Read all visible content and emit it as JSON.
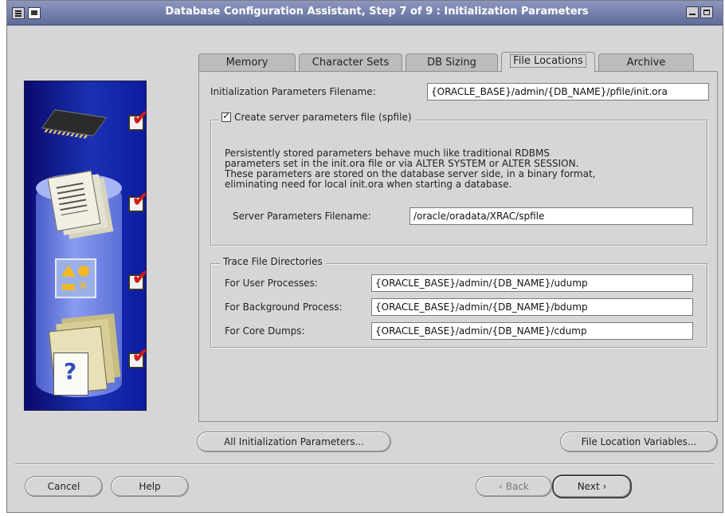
{
  "window": {
    "title": "Database Configuration Assistant, Step 7 of 9 : Initialization Parameters"
  },
  "tabs": [
    {
      "label": "Memory",
      "active": false
    },
    {
      "label": "Character Sets",
      "active": false
    },
    {
      "label": "DB Sizing",
      "active": false
    },
    {
      "label": "File Locations",
      "active": true
    },
    {
      "label": "Archive",
      "active": false
    }
  ],
  "init_params": {
    "label": "Initialization Parameters Filename:",
    "value": "{ORACLE_BASE}/admin/{DB_NAME}/pfile/init.ora"
  },
  "spfile": {
    "checkbox_label": "Create server parameters file (spfile)",
    "checked": true,
    "description_lines": [
      "Persistently stored parameters behave much like traditional RDBMS",
      "parameters set in the init.ora file or via ALTER SYSTEM or ALTER SESSION.",
      "These parameters are stored on the database server side, in a binary format,",
      "eliminating need for local init.ora when starting a database."
    ],
    "filename_label": "Server Parameters Filename:",
    "filename_value": "/oracle/oradata/XRAC/spfile"
  },
  "trace": {
    "legend": "Trace File Directories",
    "user_label": "For User Processes:",
    "user_value": "{ORACLE_BASE}/admin/{DB_NAME}/udump",
    "background_label": "For Background Process:",
    "background_value": "{ORACLE_BASE}/admin/{DB_NAME}/bdump",
    "core_label": "For Core Dumps:",
    "core_value": "{ORACLE_BASE}/admin/{DB_NAME}/cdump"
  },
  "buttons": {
    "all_init_params": "All Initialization Parameters...",
    "file_location_vars": "File Location Variables...",
    "cancel": "Cancel",
    "help": "Help",
    "back": "Back",
    "next": "Next"
  },
  "colors": {
    "panel_bg": "#d6d6d6",
    "title_bar": "#5f6c9a",
    "check_red": "#d21a1a"
  },
  "icons": [
    "chip-icon",
    "documents-icon",
    "shapes-icon",
    "help-folder-icon",
    "red-check-icon"
  ]
}
